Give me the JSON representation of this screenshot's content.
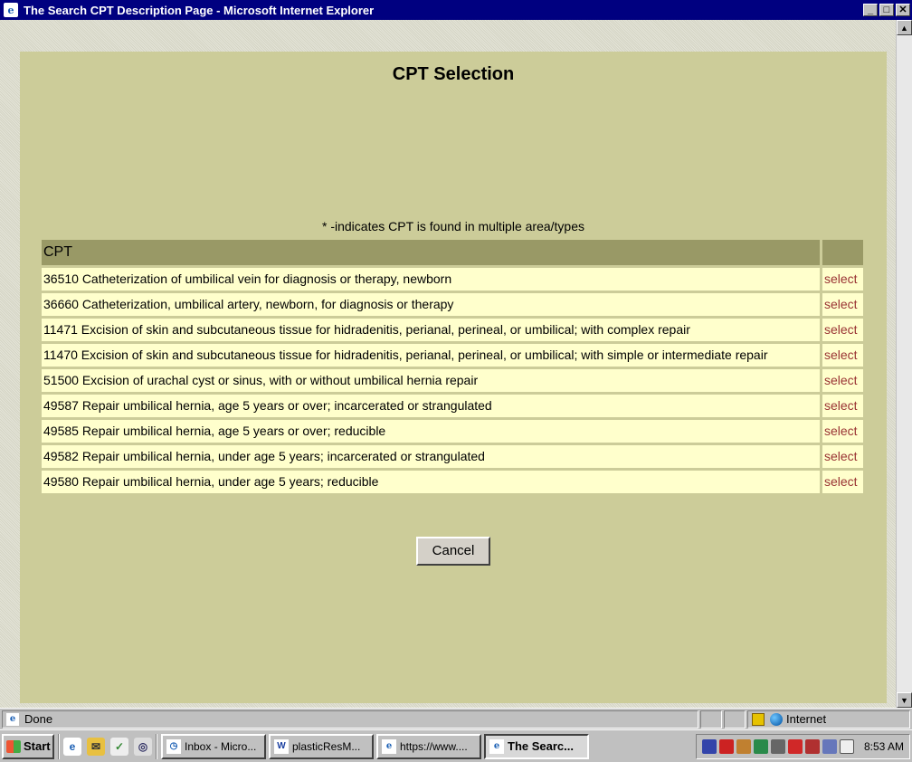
{
  "window": {
    "title": "The Search CPT Description Page - Microsoft Internet Explorer",
    "minimize": "_",
    "maximize": "□",
    "close": "✕"
  },
  "page": {
    "heading": "CPT Selection",
    "note": "* -indicates CPT is found in multiple area/types",
    "table": {
      "header": "CPT",
      "rows": [
        {
          "desc": "36510 Catheterization of umbilical vein for diagnosis or therapy, newborn",
          "action": "select"
        },
        {
          "desc": "36660 Catheterization, umbilical artery, newborn, for diagnosis or therapy",
          "action": "select"
        },
        {
          "desc": "11471 Excision of skin and subcutaneous tissue for hidradenitis, perianal, perineal, or umbilical; with complex repair",
          "action": "select"
        },
        {
          "desc": "11470 Excision of skin and subcutaneous tissue for hidradenitis, perianal, perineal, or umbilical; with simple or intermediate repair",
          "action": "select"
        },
        {
          "desc": "51500 Excision of urachal cyst or sinus, with or without umbilical hernia repair",
          "action": "select"
        },
        {
          "desc": "49587 Repair umbilical hernia, age 5 years or over; incarcerated or strangulated",
          "action": "select"
        },
        {
          "desc": "49585 Repair umbilical hernia, age 5 years or over; reducible",
          "action": "select"
        },
        {
          "desc": "49582 Repair umbilical hernia, under age 5 years; incarcerated or strangulated",
          "action": "select"
        },
        {
          "desc": "49580 Repair umbilical hernia, under age 5 years; reducible",
          "action": "select"
        }
      ]
    },
    "cancel_label": "Cancel"
  },
  "statusbar": {
    "status": "Done",
    "zone": "Internet"
  },
  "taskbar": {
    "start": "Start",
    "tasks": [
      {
        "label": "Inbox - Micro...",
        "icon": "outlook-icon"
      },
      {
        "label": "plasticResM...",
        "icon": "word-icon"
      },
      {
        "label": "https://www....",
        "icon": "ie-icon"
      },
      {
        "label": "The Searc...",
        "icon": "ie-icon",
        "active": true
      }
    ],
    "clock": "8:53 AM"
  },
  "colors": {
    "panel": "#cccc99",
    "header": "#999966",
    "row": "#ffffcc",
    "select_link": "#993333",
    "titlebar": "#000080"
  }
}
